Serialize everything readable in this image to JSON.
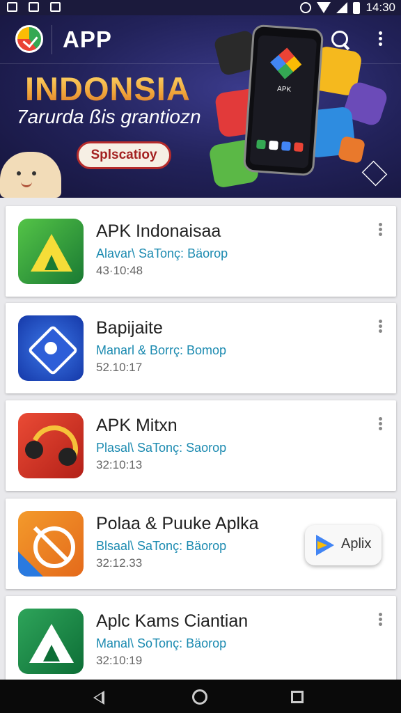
{
  "status_bar": {
    "time": "14:30"
  },
  "header": {
    "title": "APP"
  },
  "hero": {
    "headline": "INDONSIA",
    "subtitle": "7arurda ßis grantiozn",
    "button_label": "Splscatioy",
    "phone_label": "APK"
  },
  "apps": [
    {
      "title": "APK Indonaisaa",
      "subtitle": "Alavar\\ SaTonç: Bäorop",
      "time": "43·10:48",
      "icon": "a-triangle-icon"
    },
    {
      "title": "Bapijaite",
      "subtitle": "Manarl & Borrç: Bomop",
      "time": "52.10:17",
      "icon": "shield-star-icon"
    },
    {
      "title": "APK Mitxn",
      "subtitle": "Plasal\\ SaTonç: Saorop",
      "time": "32:10:13",
      "icon": "headset-icon"
    },
    {
      "title": "Polaa & Puuke Aplka",
      "subtitle": "Blsaal\\ SaTonç: Bäorop",
      "time": "32:12.33",
      "icon": "no-phone-icon",
      "action_label": "Aplix"
    },
    {
      "title": "Aplc Kams Ciantian",
      "subtitle": "Manal\\ SoTonç: Bäorop",
      "time": "32:10:19",
      "icon": "a-mountain-icon"
    }
  ]
}
